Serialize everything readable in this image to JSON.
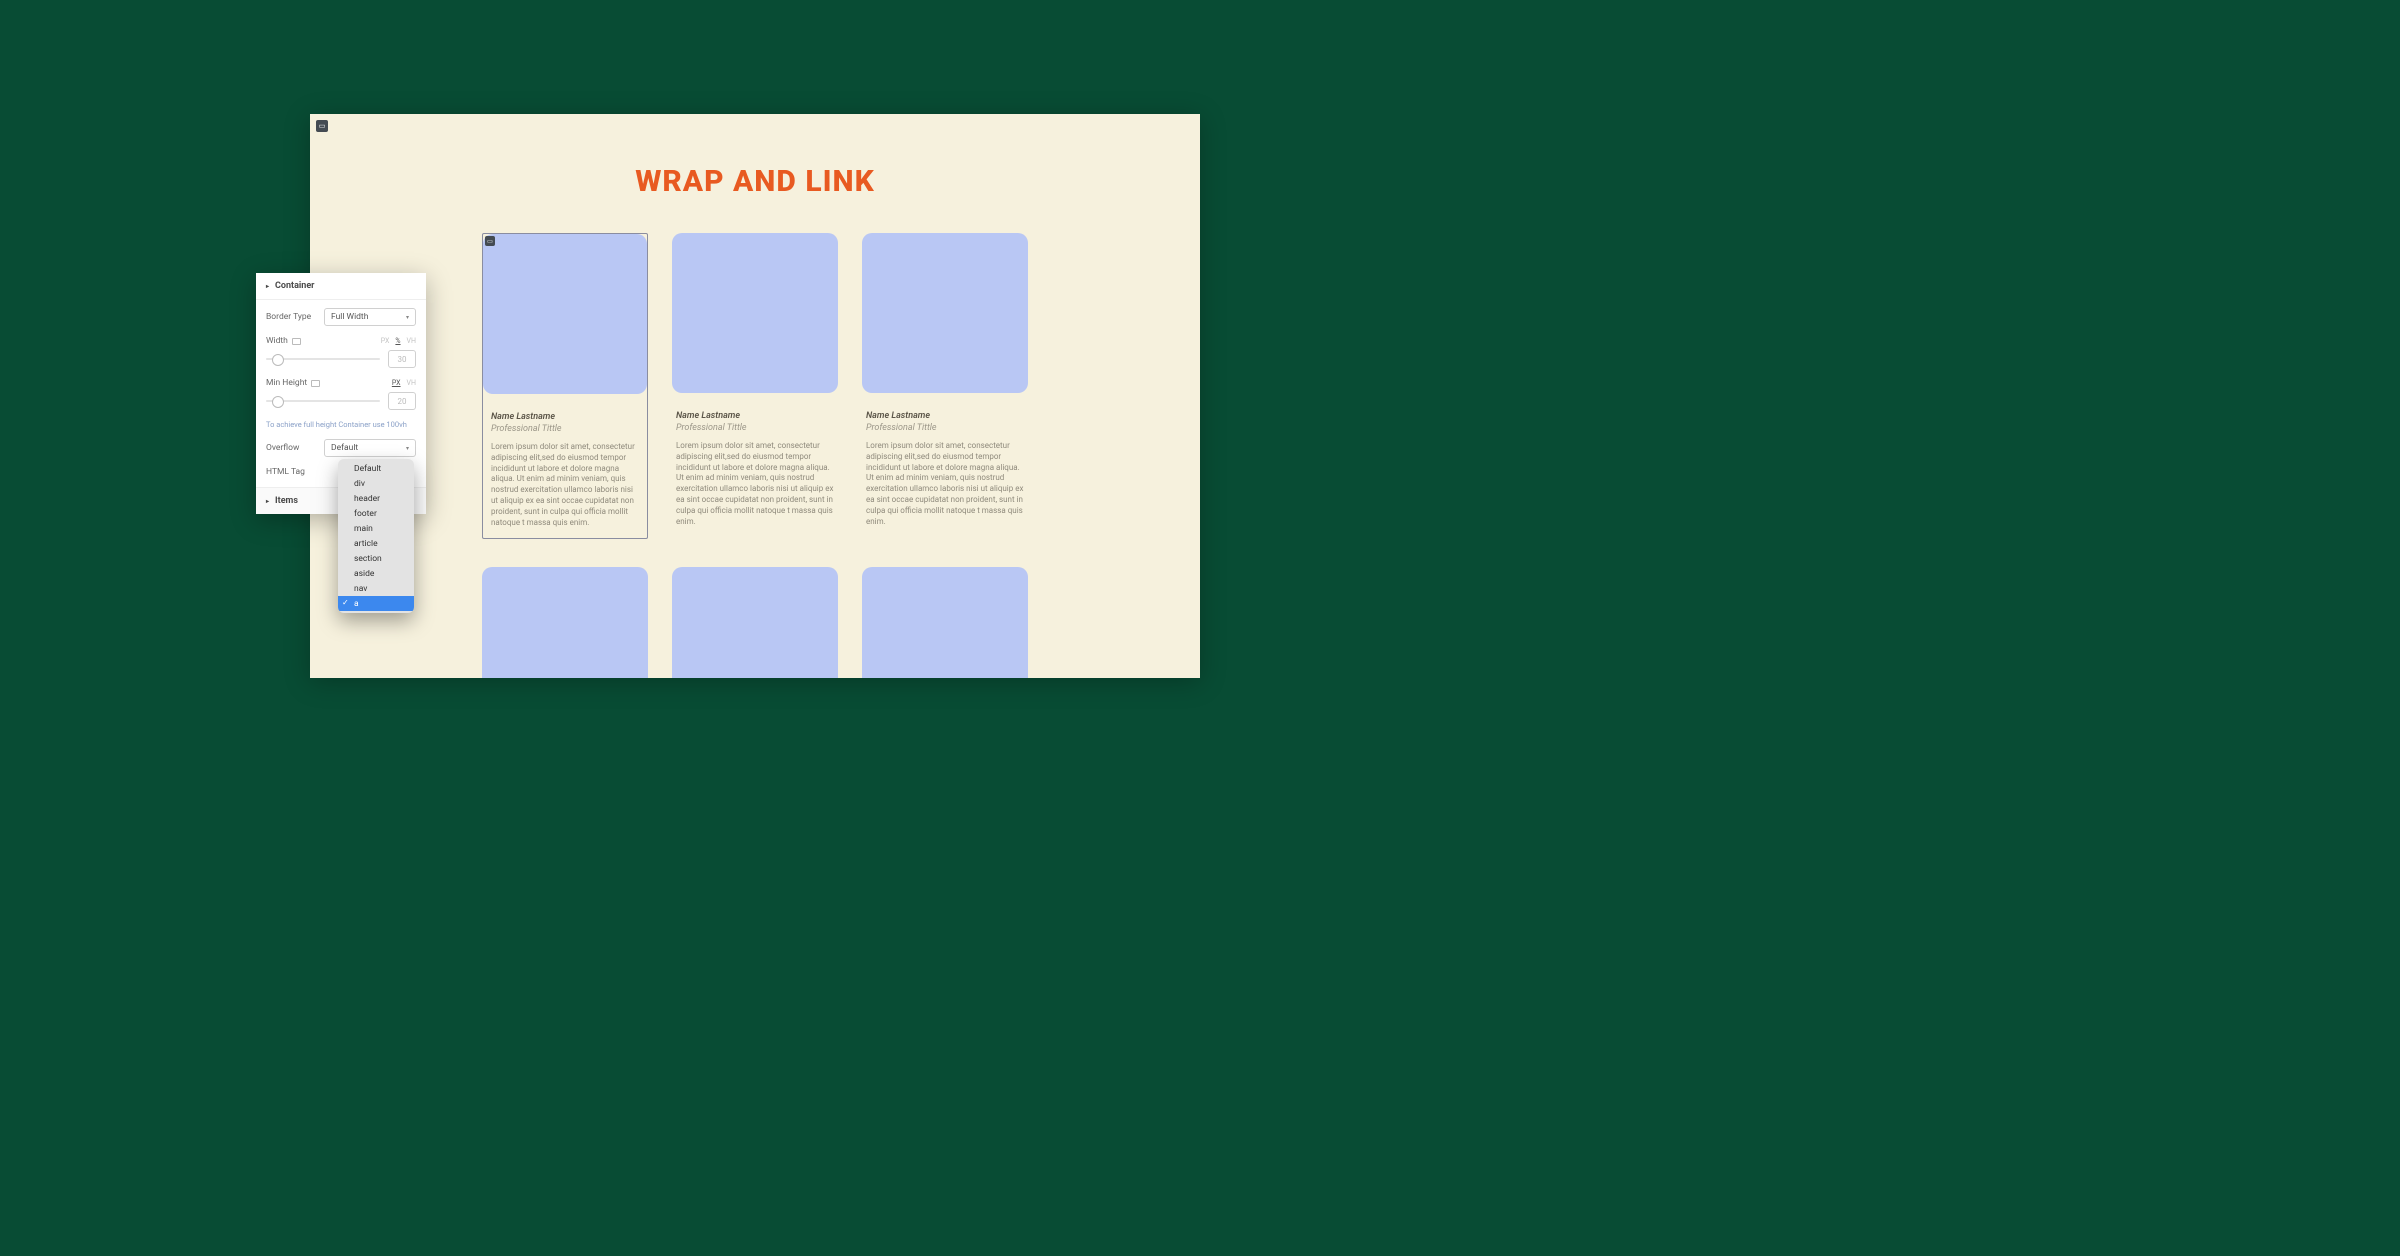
{
  "canvas": {
    "heading": "WRAP AND LINK",
    "card_name": "Name Lastname",
    "card_title": "Professional Tittle",
    "card_desc": "Lorem ipsum dolor sit amet, consectetur adipiscing elit,sed do eiusmod tempor incididunt ut labore et dolore magna aliqua. Ut enim ad minim veniam, quis nostrud exercitation ullamco laboris nisi ut aliquip ex ea sint occae cupidatat non proident, sunt in culpa qui officia mollit natoque t massa quis enim."
  },
  "panel": {
    "section_title": "Container",
    "border_type_label": "Border Type",
    "border_type_value": "Full Width",
    "width_label": "Width",
    "width_value": "30",
    "min_height_label": "Min Height",
    "min_height_value": "20",
    "units": {
      "px": "PX",
      "pct": "%",
      "vh": "VH"
    },
    "hint": "To achieve full height Container use 100vh",
    "overflow_label": "Overflow",
    "overflow_value": "Default",
    "html_tag_label": "HTML Tag",
    "items_label": "Items"
  },
  "dropdown": [
    "Default",
    "div",
    "header",
    "footer",
    "main",
    "article",
    "section",
    "aside",
    "nav",
    "a"
  ],
  "dropdown_selected": "a"
}
